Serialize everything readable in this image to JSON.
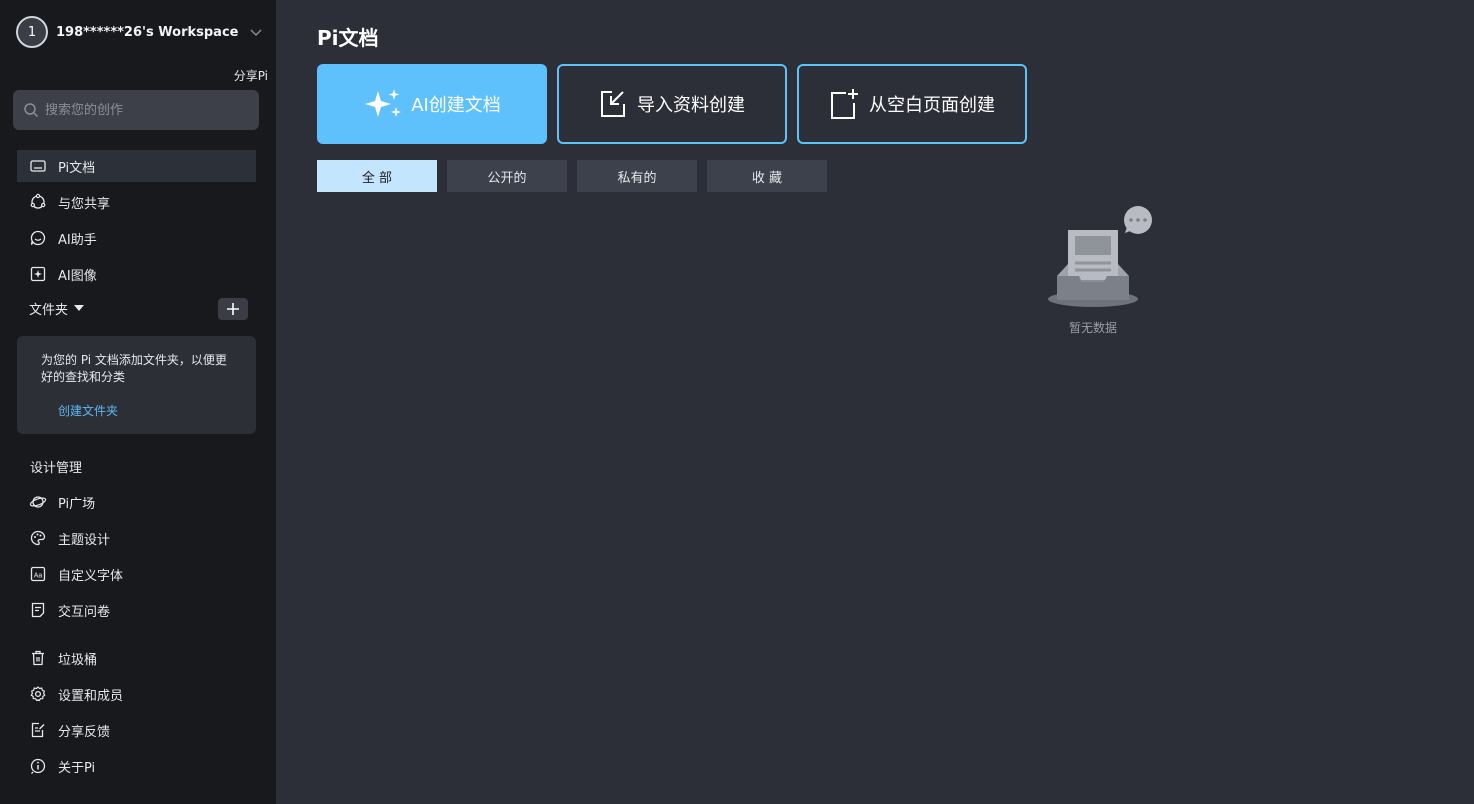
{
  "workspace": {
    "avatar_initial": "1",
    "name": "198******26's Workspace"
  },
  "sidebar": {
    "share_label": "分享Pi",
    "search_placeholder": "搜索您的创作",
    "nav": [
      {
        "label": "Pi文档",
        "icon": "document-icon",
        "active": true
      },
      {
        "label": "与您共享",
        "icon": "share-icon"
      },
      {
        "label": "AI助手",
        "icon": "chat-icon"
      },
      {
        "label": "AI图像",
        "icon": "ai-image-icon"
      }
    ],
    "folders": {
      "title": "文件夹",
      "hint": "为您的 Pi 文档添加文件夹，以便更好的查找和分类",
      "create_label": "创建文件夹"
    },
    "design_section": {
      "title": "设计管理",
      "items": [
        {
          "label": "Pi广场",
          "icon": "planet-icon"
        },
        {
          "label": "主题设计",
          "icon": "palette-icon"
        },
        {
          "label": "自定义字体",
          "icon": "font-icon"
        },
        {
          "label": "交互问卷",
          "icon": "survey-icon"
        }
      ]
    },
    "bottom": [
      {
        "label": "垃圾桶",
        "icon": "trash-icon"
      },
      {
        "label": "设置和成员",
        "icon": "gear-icon"
      },
      {
        "label": "分享反馈",
        "icon": "feedback-icon"
      },
      {
        "label": "关于Pi",
        "icon": "info-icon"
      }
    ]
  },
  "main": {
    "title": "Pi文档",
    "create_buttons": [
      {
        "label": "AI创建文档",
        "icon": "sparkle-icon"
      },
      {
        "label": "导入资料创建",
        "icon": "import-icon"
      },
      {
        "label": "从空白页面创建",
        "icon": "new-page-icon"
      }
    ],
    "tabs": [
      {
        "label": "全 部",
        "active": true
      },
      {
        "label": "公开的"
      },
      {
        "label": "私有的"
      },
      {
        "label": "收 藏"
      }
    ],
    "empty_state": "暂无数据"
  },
  "colors": {
    "accent": "#5ec1fb",
    "sidebar_bg": "#17191d",
    "main_bg": "#2c2f38",
    "tab_active_bg": "#c3e5fd",
    "link": "#5fb8f0"
  }
}
